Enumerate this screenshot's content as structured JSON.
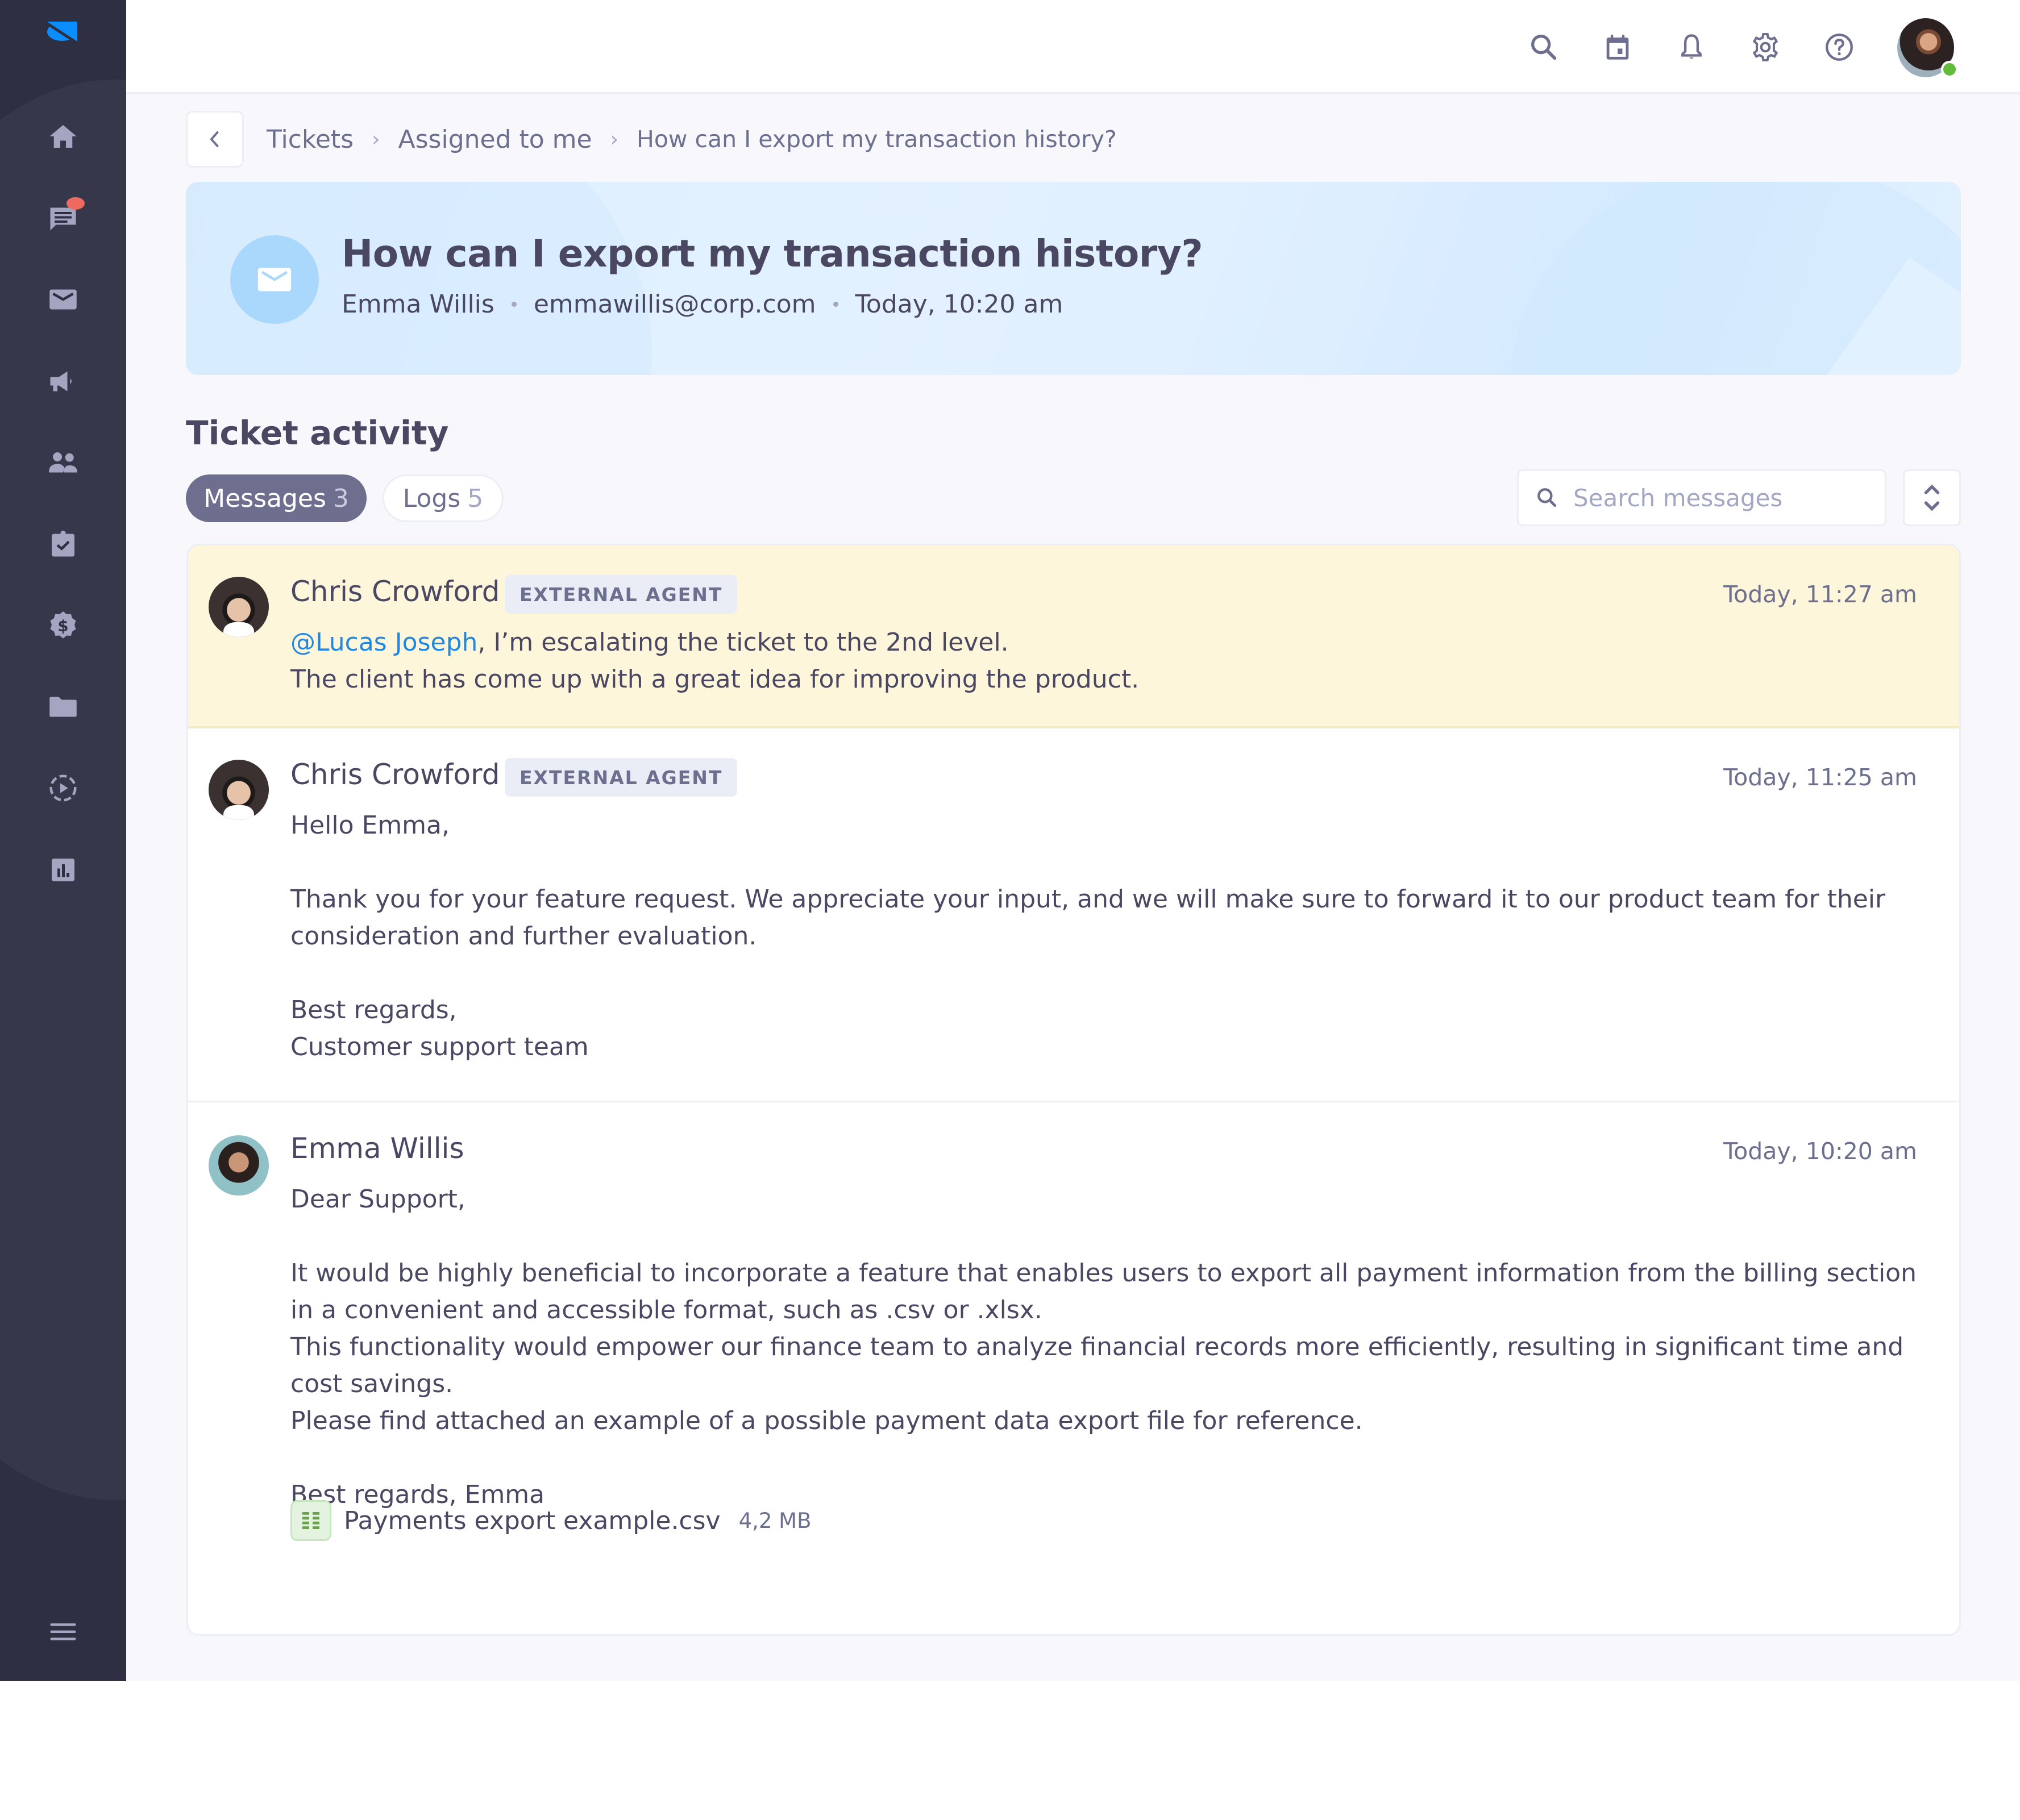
{
  "sidebar": {
    "logo": "brand-logo",
    "items": [
      {
        "name": "home",
        "icon": "home-icon"
      },
      {
        "name": "chats",
        "icon": "chat-icon",
        "has_badge": true
      },
      {
        "name": "mail",
        "icon": "mail-icon"
      },
      {
        "name": "campaigns",
        "icon": "megaphone-icon"
      },
      {
        "name": "contacts",
        "icon": "people-icon"
      },
      {
        "name": "tasks",
        "icon": "clipboard-check-icon"
      },
      {
        "name": "billing",
        "icon": "dollar-badge-icon"
      },
      {
        "name": "files",
        "icon": "folder-icon"
      },
      {
        "name": "recordings",
        "icon": "play-circle-icon"
      },
      {
        "name": "reports",
        "icon": "bar-chart-icon"
      }
    ],
    "menu_icon": "hamburger-menu-icon"
  },
  "topbar": {
    "icons": [
      "search-icon",
      "calendar-icon",
      "bell-icon",
      "gear-icon",
      "help-icon"
    ],
    "user_status": "online",
    "status_color": "#62bb3a"
  },
  "breadcrumb": {
    "items": [
      "Tickets",
      "Assigned to me",
      "How can I export my transaction history?"
    ]
  },
  "ticket": {
    "title": "How can I export my transaction history?",
    "requester": "Emma Willis",
    "email": "emmawillis@corp.com",
    "created": "Today, 10:20 am",
    "channel_icon": "mail-icon"
  },
  "activity": {
    "title": "Ticket activity",
    "tabs": [
      {
        "label": "Messages",
        "count": "3",
        "active": true
      },
      {
        "label": "Logs",
        "count": "5",
        "active": false
      }
    ],
    "search": {
      "placeholder": "Search messages",
      "value": ""
    }
  },
  "messages": [
    {
      "author": "Chris Crowford",
      "badge": "EXTERNAL AGENT",
      "time": "Today, 11:27 am",
      "highlighted": true,
      "mention": "@Lucas Joseph",
      "lines": [
        ", I’m escalating the ticket to the 2nd level.",
        "The client has come up with a great idea for improving the product."
      ]
    },
    {
      "author": "Chris Crowford",
      "badge": "EXTERNAL AGENT",
      "time": "Today, 11:25 am",
      "highlighted": false,
      "lines": [
        "Hello Emma,",
        "",
        "Thank you for your feature request. We appreciate your input, and we will make sure to forward it to our product team for their consideration and further evaluation.",
        "",
        "Best regards,",
        "Customer support team"
      ]
    },
    {
      "author": "Emma Willis",
      "badge": "",
      "time": "Today, 10:20 am",
      "highlighted": false,
      "lines": [
        "Dear Support,",
        "",
        "It would be highly beneficial to incorporate a feature that enables users to export all payment information from the billing section in a convenient and accessible format, such as .csv or .xlsx.",
        "This functionality would empower our finance team to analyze financial records more efficiently, resulting in significant time and cost savings.",
        "Please find attached an example of a possible payment data export file for reference.",
        "",
        "Best regards, Emma"
      ],
      "attachment": {
        "name": "Payments export example.csv",
        "size": "4,2 MB",
        "icon": "spreadsheet-file-icon"
      }
    }
  ],
  "colors": {
    "sidebar_bg": "#2f2f43",
    "accent": "#1e88e5",
    "logo": "#0a8dfd",
    "notification": "#ee6a61",
    "highlight_bg": "#fef6db",
    "tab_active_bg": "#6e6f8f"
  }
}
